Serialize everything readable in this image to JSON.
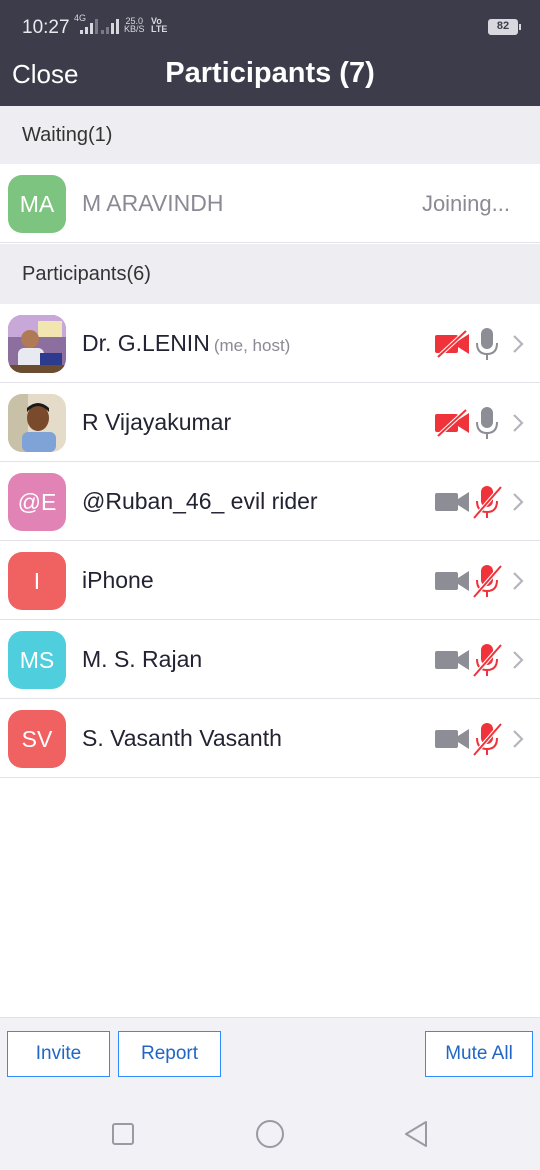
{
  "status_bar": {
    "time": "10:27",
    "network": "4G",
    "speed_value": "25.0",
    "speed_unit": "KB/S",
    "volte_top": "Vo",
    "volte_bottom": "LTE",
    "battery": "82"
  },
  "header": {
    "close_label": "Close",
    "title": "Participants (7)"
  },
  "waiting": {
    "header": "Waiting(1)",
    "items": [
      {
        "initials": "MA",
        "name": "M ARAVINDH",
        "status": "Joining...",
        "avatar_color": "#7cc47f"
      }
    ]
  },
  "participants": {
    "header": "Participants(6)",
    "items": [
      {
        "initials": "",
        "name": "Dr. G.LENIN",
        "tag": "(me, host)",
        "photo": true,
        "video": "off",
        "audio": "on"
      },
      {
        "initials": "",
        "name": "R Vijayakumar",
        "tag": "",
        "photo": true,
        "video": "off",
        "audio": "on"
      },
      {
        "initials": "@E",
        "name": "@Ruban_46_ evil rider",
        "tag": "",
        "avatar_color": "#e283b6",
        "video": "on",
        "audio": "muted"
      },
      {
        "initials": "I",
        "name": "iPhone",
        "tag": "",
        "avatar_color": "#f06262",
        "video": "on",
        "audio": "muted"
      },
      {
        "initials": "MS",
        "name": "M. S. Rajan",
        "tag": "",
        "avatar_color": "#4fcfdd",
        "video": "on",
        "audio": "muted"
      },
      {
        "initials": "SV",
        "name": "S. Vasanth Vasanth",
        "tag": "",
        "avatar_color": "#f06262",
        "video": "on",
        "audio": "muted"
      }
    ]
  },
  "footer": {
    "invite_label": "Invite",
    "report_label": "Report",
    "mute_all_label": "Mute All"
  },
  "colors": {
    "header_bg": "#3c3c4a",
    "accent": "#2d8cff",
    "muted_red": "#f0333b",
    "icon_gray": "#8d8d96"
  }
}
